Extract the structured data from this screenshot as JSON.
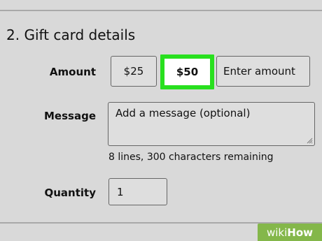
{
  "section": {
    "title": "2. Gift card details"
  },
  "amount": {
    "label": "Amount",
    "options": [
      {
        "label": "$25",
        "selected": false
      },
      {
        "label": "$50",
        "selected": true
      }
    ],
    "custom_placeholder": "Enter amount",
    "highlight_color": "#28e01e"
  },
  "message": {
    "label": "Message",
    "placeholder": "Add a message (optional)",
    "counter": "8 lines, 300 characters remaining"
  },
  "quantity": {
    "label": "Quantity",
    "value": "1"
  },
  "watermark": {
    "wiki": "wiki",
    "how": "How",
    "color": "#84b74a"
  }
}
